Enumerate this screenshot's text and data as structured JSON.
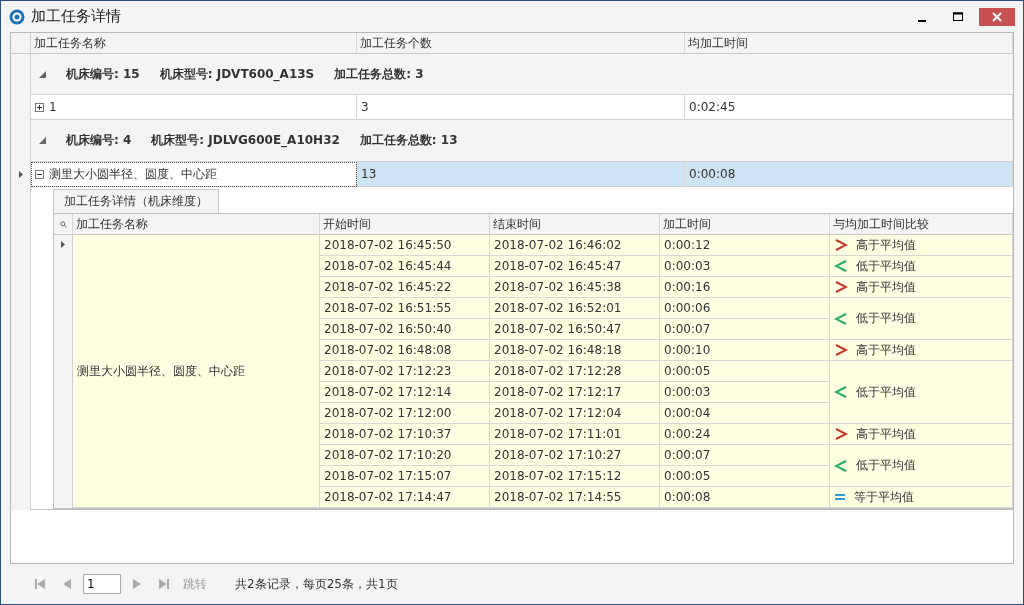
{
  "window": {
    "title": "加工任务详情"
  },
  "table": {
    "columns": [
      "加工任务名称",
      "加工任务个数",
      "均加工时间"
    ],
    "groups": [
      {
        "fields": [
          "机床编号: 15",
          "机床型号: JDVT600_A13S",
          "加工任务总数: 3"
        ],
        "expanded": true,
        "rows": [
          {
            "name": "1",
            "count": "3",
            "avg": "0:02:45",
            "expanded": false,
            "selected": false
          }
        ]
      },
      {
        "fields": [
          "机床编号: 4",
          "机床型号: JDLVG600E_A10H32",
          "加工任务总数: 13"
        ],
        "expanded": true,
        "rows": [
          {
            "name": "测里大小圆半径、圆度、中心距",
            "count": "13",
            "avg": "0:00:08",
            "expanded": true,
            "selected": true
          }
        ]
      }
    ]
  },
  "detail": {
    "tab": "加工任务详情（机床维度）",
    "columns": [
      "加工任务名称",
      "开始时间",
      "结束时间",
      "加工时间",
      "与均加工时间比较"
    ],
    "task_name": "测里大小圆半径、圆度、中心距",
    "groups": [
      {
        "kind": "higher",
        "label": "高于平均值",
        "rows": [
          {
            "start": "2018-07-02 16:45:50",
            "end": "2018-07-02 16:46:02",
            "duration": "0:00:12"
          }
        ]
      },
      {
        "kind": "lower",
        "label": "低于平均值",
        "rows": [
          {
            "start": "2018-07-02 16:45:44",
            "end": "2018-07-02 16:45:47",
            "duration": "0:00:03"
          }
        ]
      },
      {
        "kind": "higher",
        "label": "高于平均值",
        "rows": [
          {
            "start": "2018-07-02 16:45:22",
            "end": "2018-07-02 16:45:38",
            "duration": "0:00:16"
          }
        ]
      },
      {
        "kind": "lower",
        "label": "低于平均值",
        "rows": [
          {
            "start": "2018-07-02 16:51:55",
            "end": "2018-07-02 16:52:01",
            "duration": "0:00:06"
          },
          {
            "start": "2018-07-02 16:50:40",
            "end": "2018-07-02 16:50:47",
            "duration": "0:00:07"
          }
        ]
      },
      {
        "kind": "higher",
        "label": "高于平均值",
        "rows": [
          {
            "start": "2018-07-02 16:48:08",
            "end": "2018-07-02 16:48:18",
            "duration": "0:00:10"
          }
        ]
      },
      {
        "kind": "lower",
        "label": "低于平均值",
        "rows": [
          {
            "start": "2018-07-02 17:12:23",
            "end": "2018-07-02 17:12:28",
            "duration": "0:00:05"
          },
          {
            "start": "2018-07-02 17:12:14",
            "end": "2018-07-02 17:12:17",
            "duration": "0:00:03"
          },
          {
            "start": "2018-07-02 17:12:00",
            "end": "2018-07-02 17:12:04",
            "duration": "0:00:04"
          }
        ]
      },
      {
        "kind": "higher",
        "label": "高于平均值",
        "rows": [
          {
            "start": "2018-07-02 17:10:37",
            "end": "2018-07-02 17:11:01",
            "duration": "0:00:24"
          }
        ]
      },
      {
        "kind": "lower",
        "label": "低于平均值",
        "rows": [
          {
            "start": "2018-07-02 17:10:20",
            "end": "2018-07-02 17:10:27",
            "duration": "0:00:07"
          },
          {
            "start": "2018-07-02 17:15:07",
            "end": "2018-07-02 17:15:12",
            "duration": "0:00:05"
          }
        ]
      },
      {
        "kind": "equal",
        "label": "等于平均值",
        "rows": [
          {
            "start": "2018-07-02 17:14:47",
            "end": "2018-07-02 17:14:55",
            "duration": "0:00:08"
          }
        ]
      }
    ]
  },
  "pager": {
    "page": "1",
    "jump": "跳转",
    "info": "共2条记录，每页25条，共1页"
  }
}
